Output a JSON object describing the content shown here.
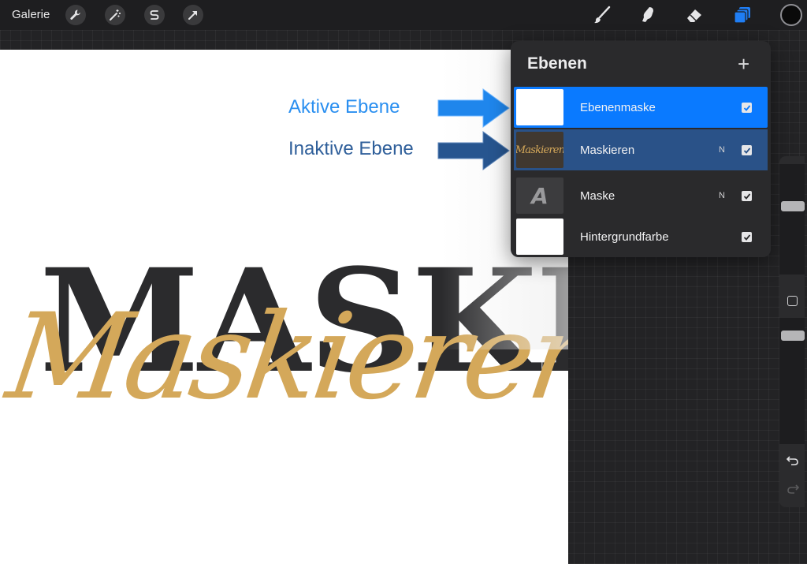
{
  "topbar": {
    "gallery_label": "Galerie",
    "left_tools": [
      "wrench-icon",
      "magic-wand-icon",
      "selection-s-icon",
      "transform-arrow-icon"
    ],
    "right_tools": [
      "brush-icon",
      "smudge-icon",
      "eraser-icon",
      "layers-icon"
    ],
    "active_tool_color": "#1f7ef5",
    "current_color": "#0a0a0a"
  },
  "canvas": {
    "text_serif": "MASKE",
    "text_script": "Maskieren",
    "serif_color": "#2b2b2d",
    "script_color": "#d4a85a"
  },
  "annotations": {
    "active_label": "Aktive Ebene",
    "inactive_label": "Inaktive Ebene",
    "active_color": "#2a8ff0",
    "inactive_color": "#2f5f9a"
  },
  "layers_panel": {
    "title": "Ebenen",
    "add_label": "+",
    "layers": [
      {
        "name": "Ebenenmaske",
        "blend": "",
        "visible": true,
        "state": "active"
      },
      {
        "name": "Maskieren",
        "blend": "N",
        "visible": true,
        "state": "selected"
      },
      {
        "name": "Maske",
        "blend": "N",
        "visible": true,
        "state": "normal"
      },
      {
        "name": "Hintergrundfarbe",
        "blend": "",
        "visible": true,
        "state": "normal"
      }
    ],
    "mask_thumb_text": "Maskieren",
    "maske_thumb_letter": "A"
  },
  "sidebar": {
    "brush_size_level": 0.0,
    "opacity_level": 0.0
  }
}
